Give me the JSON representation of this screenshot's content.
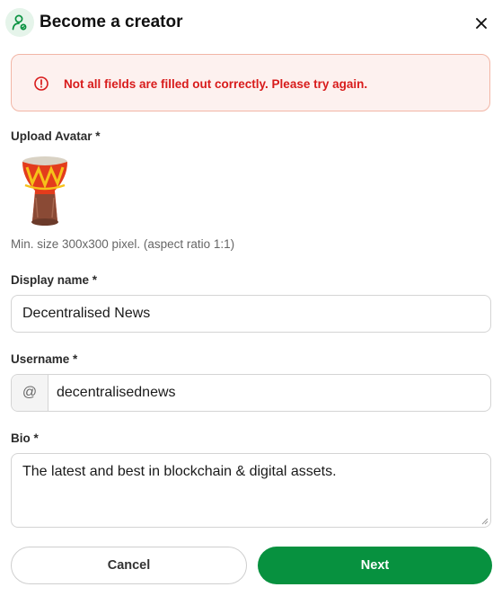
{
  "header": {
    "title": "Become a creator",
    "icon": "creator-user-icon",
    "close_icon": "close-icon"
  },
  "alert": {
    "icon": "error-circle-icon",
    "message": "Not all fields are filled out correctly. Please try again."
  },
  "avatar": {
    "label": "Upload Avatar *",
    "image": "djembe-drum-avatar",
    "hint": "Min. size 300x300 pixel. (aspect ratio 1:1)"
  },
  "display_name": {
    "label": "Display name *",
    "value": "Decentralised News"
  },
  "username": {
    "label": "Username *",
    "prefix": "@",
    "value": "decentralisednews"
  },
  "bio": {
    "label": "Bio *",
    "value": "The latest and best in blockchain & digital assets."
  },
  "buttons": {
    "cancel": "Cancel",
    "next": "Next"
  },
  "colors": {
    "accent_green": "#07913f",
    "error_red": "#d81b1b",
    "alert_bg": "#fdf1ef"
  }
}
